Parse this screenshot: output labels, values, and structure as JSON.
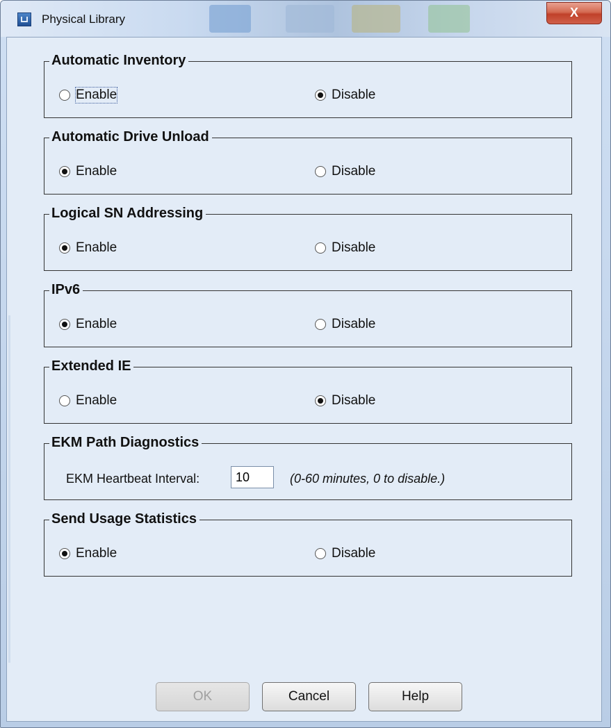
{
  "window": {
    "title": "Physical Library",
    "close_label": "X"
  },
  "groups": [
    {
      "title": "Automatic Inventory",
      "enable_label": "Enable",
      "disable_label": "Disable",
      "selected": "disable"
    },
    {
      "title": "Automatic Drive Unload",
      "enable_label": "Enable",
      "disable_label": "Disable",
      "selected": "enable"
    },
    {
      "title": "Logical SN Addressing",
      "enable_label": "Enable",
      "disable_label": "Disable",
      "selected": "enable"
    },
    {
      "title": "IPv6",
      "enable_label": "Enable",
      "disable_label": "Disable",
      "selected": "enable"
    },
    {
      "title": "Extended IE",
      "enable_label": "Enable",
      "disable_label": "Disable",
      "selected": "disable"
    }
  ],
  "ekm": {
    "title": "EKM Path Diagnostics",
    "label": "EKM Heartbeat Interval:",
    "value": "10",
    "hint": "(0-60 minutes, 0 to disable.)"
  },
  "usage": {
    "title": "Send Usage Statistics",
    "enable_label": "Enable",
    "disable_label": "Disable",
    "selected": "enable"
  },
  "buttons": {
    "ok": "OK",
    "cancel": "Cancel",
    "help": "Help"
  }
}
